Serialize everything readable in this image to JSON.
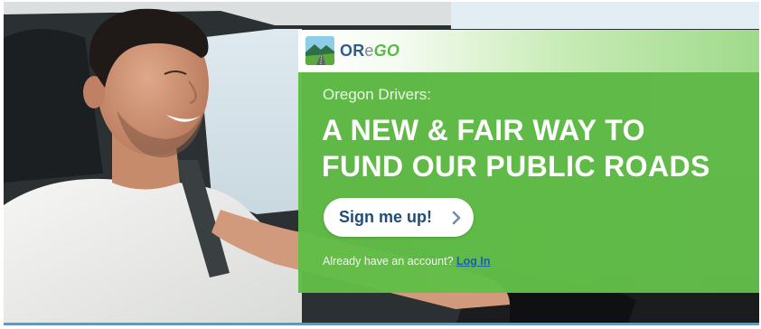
{
  "brand": {
    "logo_or": "OR",
    "logo_e": "e",
    "logo_go": "GO",
    "logo_icon": "road-landscape-icon",
    "accent_color": "#62C048",
    "navy_color": "#1F4D78"
  },
  "hero": {
    "eyebrow": "Oregon Drivers:",
    "headline_line1": "A NEW & FAIR WAY TO",
    "headline_line2": "FUND OUR PUBLIC ROADS",
    "photo_icon": "smiling-driver-photo"
  },
  "cta": {
    "signup_label": "Sign me up!",
    "signup_icon": "chevron-right-icon",
    "account_prompt": "Already have an account?",
    "login_label": "Log In"
  }
}
